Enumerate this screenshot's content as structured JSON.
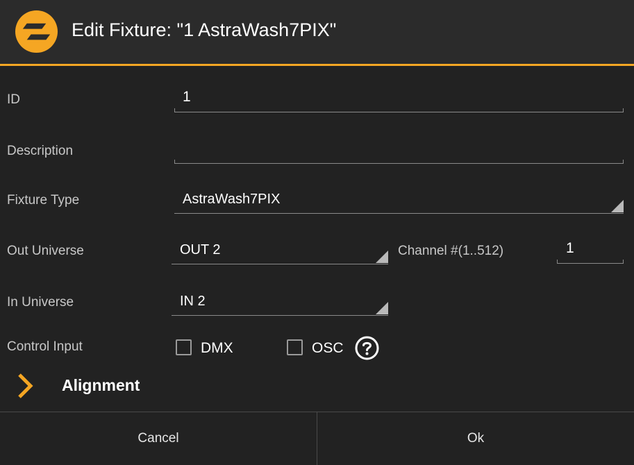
{
  "dialog": {
    "title": "Edit Fixture: \"1 AstraWash7PIX\"",
    "logo": "app-logo-icon",
    "accent_color": "#f5a623"
  },
  "fields": {
    "id": {
      "label": "ID",
      "value": "1"
    },
    "description": {
      "label": "Description",
      "value": ""
    },
    "fixture_type": {
      "label": "Fixture Type",
      "value": "AstraWash7PIX"
    },
    "out_universe": {
      "label": "Out Universe",
      "value": "OUT 2"
    },
    "channel": {
      "label": "Channel #(1..512)",
      "value": "1"
    },
    "in_universe": {
      "label": "In Universe",
      "value": "IN 2"
    },
    "control_input": {
      "label": "Control Input",
      "dmx": {
        "label": "DMX",
        "checked": false
      },
      "osc": {
        "label": "OSC",
        "checked": false
      },
      "help_icon": "help-circle-icon"
    }
  },
  "alignment": {
    "label": "Alignment",
    "icon": "chevron-right-icon"
  },
  "footer": {
    "cancel_label": "Cancel",
    "ok_label": "Ok"
  }
}
